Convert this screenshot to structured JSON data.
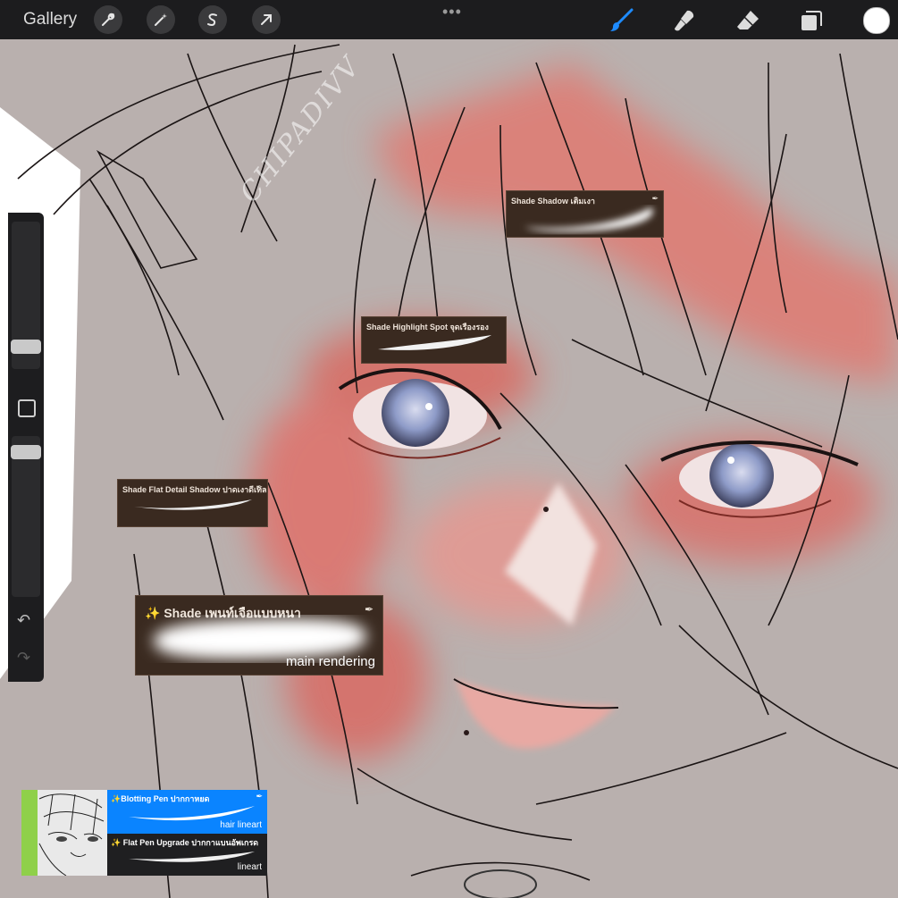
{
  "topbar": {
    "gallery_label": "Gallery",
    "left_tools": [
      "wrench-icon",
      "magic-wand-icon",
      "selection-icon",
      "transform-arrow-icon"
    ],
    "more_label": "•••",
    "right_tools": [
      "brush-icon",
      "smudge-icon",
      "eraser-icon",
      "layers-icon"
    ],
    "current_color": "#ffffff",
    "brush_accent": "#1e8bff"
  },
  "sidebar": {
    "undo_icon": "↶",
    "redo_icon": "↷"
  },
  "watermark": "CHIPADIVV",
  "brushes": {
    "shade_shadow": {
      "name": "Shade Shadow เติมเงา"
    },
    "highlight_spot": {
      "name": "Shade Highlight Spot จุดเรืองรอง"
    },
    "flat_detail": {
      "name": "Shade Flat Detail Shadow ปาดเงาดีเทล"
    },
    "main": {
      "name": "✨ Shade เพนท์เจือแบบหนา",
      "sub": "main rendering"
    }
  },
  "brush_panel": {
    "blotting": {
      "name": "✨Blotting Pen ปากกาหยด",
      "sub": "hair lineart"
    },
    "flat_pen": {
      "name": "✨ Flat Pen Upgrade ปากกาแบนอัพเกรด",
      "sub": "lineart"
    }
  },
  "colors": {
    "canvas_bg": "#b9b0ae",
    "blush": "#e0716a",
    "iris": "#8e9bc8",
    "card_bg": "#3a2a20"
  }
}
